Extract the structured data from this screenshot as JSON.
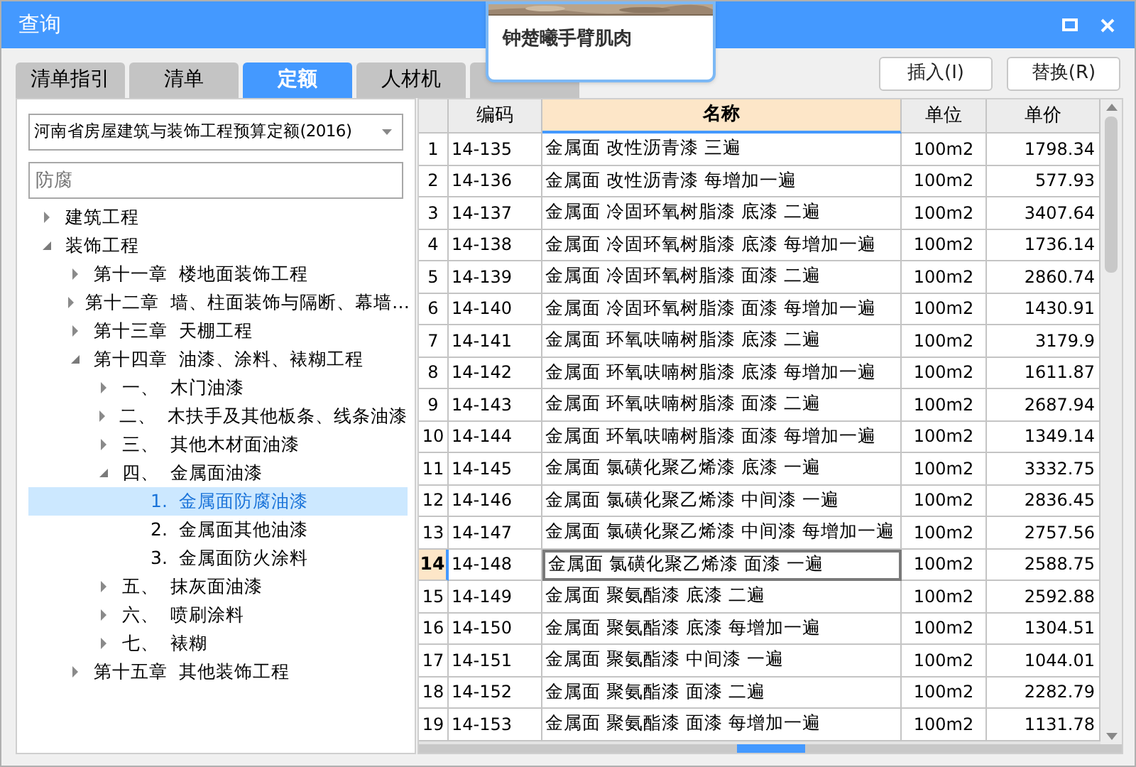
{
  "window": {
    "title": "查询"
  },
  "popup": {
    "caption": "钟楚曦手臂肌肉"
  },
  "tabs": [
    {
      "label": "清单指引",
      "selected": false
    },
    {
      "label": "清单",
      "selected": false
    },
    {
      "label": "定额",
      "selected": true
    },
    {
      "label": "人材机",
      "selected": false
    }
  ],
  "buttons": [
    "插入(I)",
    "替换(R)"
  ],
  "quota_select": {
    "value": "河南省房屋建筑与装饰工程预算定额(2016)"
  },
  "search": {
    "value": "防腐"
  },
  "tree": [
    {
      "label": "建筑工程",
      "expanded": false,
      "selected": false
    },
    {
      "label": "装饰工程",
      "expanded": true,
      "selected": false,
      "children": [
        {
          "label": "第十一章  楼地面装饰工程",
          "expanded": false,
          "selected": false
        },
        {
          "label": "第十二章  墙、柱面装饰与隔断、幕墙…",
          "expanded": false,
          "selected": false
        },
        {
          "label": "第十三章  天棚工程",
          "expanded": false,
          "selected": false
        },
        {
          "label": "第十四章  油漆、涂料、裱糊工程",
          "expanded": true,
          "selected": false,
          "children": [
            {
              "label": "一、  木门油漆",
              "expanded": false,
              "selected": false
            },
            {
              "label": "二、  木扶手及其他板条、线条油漆",
              "expanded": false,
              "selected": false
            },
            {
              "label": "三、  其他木材面油漆",
              "expanded": false,
              "selected": false
            },
            {
              "label": "四、  金属面油漆",
              "expanded": true,
              "selected": false,
              "children": [
                {
                  "label": "1.  金属面防腐油漆",
                  "selected": true
                },
                {
                  "label": "2.  金属面其他油漆",
                  "selected": false
                },
                {
                  "label": "3.  金属面防火涂料",
                  "selected": false
                }
              ]
            },
            {
              "label": "五、  抹灰面油漆",
              "expanded": false,
              "selected": false
            },
            {
              "label": "六、  喷刷涂料",
              "expanded": false,
              "selected": false
            },
            {
              "label": "七、  裱糊",
              "expanded": false,
              "selected": false
            }
          ]
        },
        {
          "label": "第十五章  其他装饰工程",
          "expanded": false,
          "selected": false
        }
      ]
    }
  ],
  "table": {
    "columns": [
      {
        "label": "编码",
        "selected": false
      },
      {
        "label": "名称",
        "selected": true
      },
      {
        "label": "单位",
        "selected": false
      },
      {
        "label": "单价",
        "selected": false
      }
    ],
    "rows": [
      {
        "index": "1",
        "code": "14-135",
        "name": "金属面 改性沥青漆 三遍",
        "unit": "100m2",
        "price": "1798.34",
        "selected": false
      },
      {
        "index": "2",
        "code": "14-136",
        "name": "金属面 改性沥青漆 每增加一遍",
        "unit": "100m2",
        "price": "577.93",
        "selected": false
      },
      {
        "index": "3",
        "code": "14-137",
        "name": "金属面 冷固环氧树脂漆 底漆 二遍",
        "unit": "100m2",
        "price": "3407.64",
        "selected": false
      },
      {
        "index": "4",
        "code": "14-138",
        "name": "金属面 冷固环氧树脂漆 底漆 每增加一遍",
        "unit": "100m2",
        "price": "1736.14",
        "selected": false
      },
      {
        "index": "5",
        "code": "14-139",
        "name": "金属面 冷固环氧树脂漆 面漆 二遍",
        "unit": "100m2",
        "price": "2860.74",
        "selected": false
      },
      {
        "index": "6",
        "code": "14-140",
        "name": "金属面 冷固环氧树脂漆 面漆 每增加一遍",
        "unit": "100m2",
        "price": "1430.91",
        "selected": false
      },
      {
        "index": "7",
        "code": "14-141",
        "name": "金属面 环氧呋喃树脂漆 底漆 二遍",
        "unit": "100m2",
        "price": "3179.9",
        "selected": false
      },
      {
        "index": "8",
        "code": "14-142",
        "name": "金属面 环氧呋喃树脂漆 底漆 每增加一遍",
        "unit": "100m2",
        "price": "1611.87",
        "selected": false
      },
      {
        "index": "9",
        "code": "14-143",
        "name": "金属面 环氧呋喃树脂漆 面漆 二遍",
        "unit": "100m2",
        "price": "2687.94",
        "selected": false
      },
      {
        "index": "10",
        "code": "14-144",
        "name": "金属面 环氧呋喃树脂漆 面漆 每增加一遍",
        "unit": "100m2",
        "price": "1349.14",
        "selected": false
      },
      {
        "index": "11",
        "code": "14-145",
        "name": "金属面 氯磺化聚乙烯漆 底漆 一遍",
        "unit": "100m2",
        "price": "3332.75",
        "selected": false
      },
      {
        "index": "12",
        "code": "14-146",
        "name": "金属面 氯磺化聚乙烯漆 中间漆 一遍",
        "unit": "100m2",
        "price": "2836.45",
        "selected": false
      },
      {
        "index": "13",
        "code": "14-147",
        "name": "金属面 氯磺化聚乙烯漆 中间漆 每增加一遍",
        "unit": "100m2",
        "price": "2757.56",
        "selected": false
      },
      {
        "index": "14",
        "code": "14-148",
        "name": "金属面 氯磺化聚乙烯漆 面漆 一遍",
        "unit": "100m2",
        "price": "2588.75",
        "selected": true
      },
      {
        "index": "15",
        "code": "14-149",
        "name": "金属面 聚氨酯漆 底漆 二遍",
        "unit": "100m2",
        "price": "2592.88",
        "selected": false
      },
      {
        "index": "16",
        "code": "14-150",
        "name": "金属面 聚氨酯漆 底漆 每增加一遍",
        "unit": "100m2",
        "price": "1304.51",
        "selected": false
      },
      {
        "index": "17",
        "code": "14-151",
        "name": "金属面 聚氨酯漆 中间漆 一遍",
        "unit": "100m2",
        "price": "1044.01",
        "selected": false
      },
      {
        "index": "18",
        "code": "14-152",
        "name": "金属面 聚氨酯漆 面漆 二遍",
        "unit": "100m2",
        "price": "2282.79",
        "selected": false
      },
      {
        "index": "19",
        "code": "14-153",
        "name": "金属面 聚氨酯漆 面漆 每增加一遍",
        "unit": "100m2",
        "price": "1131.78",
        "selected": false
      }
    ]
  }
}
